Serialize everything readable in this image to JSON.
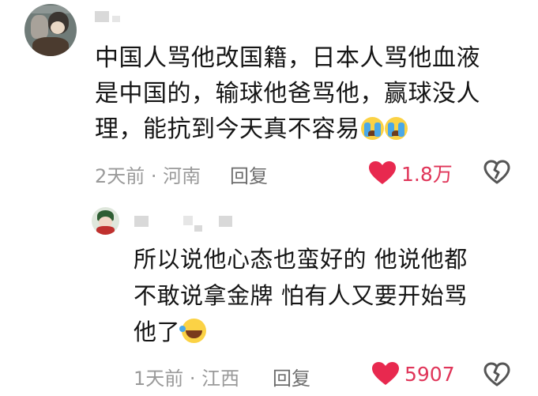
{
  "comment": {
    "lines": [
      "中国人骂他改国籍，日本人骂他血液",
      "是中国的，输球他爸骂他，赢球没人",
      "理，能抗到今天真不容易"
    ],
    "meta": "2天前 · 河南",
    "reply_label": "回复",
    "likes": "1.8万",
    "emojis": [
      "crying-face",
      "crying-face"
    ]
  },
  "reply": {
    "lines": [
      "所以说他心态也蛮好的 他说他都",
      "不敢说拿金牌 怕有人又要开始骂",
      "他了"
    ],
    "meta": "1天前 · 江西",
    "reply_label": "回复",
    "likes": "5907",
    "emojis": [
      "rolling-laugh-face"
    ]
  },
  "colors": {
    "like_heart": "#e8294f",
    "like_count": "#e03559",
    "meta_text": "#9a9a9a",
    "redacted_name": "#d9d9d9"
  },
  "icons": [
    "heart-icon",
    "dislike-heart-icon"
  ]
}
